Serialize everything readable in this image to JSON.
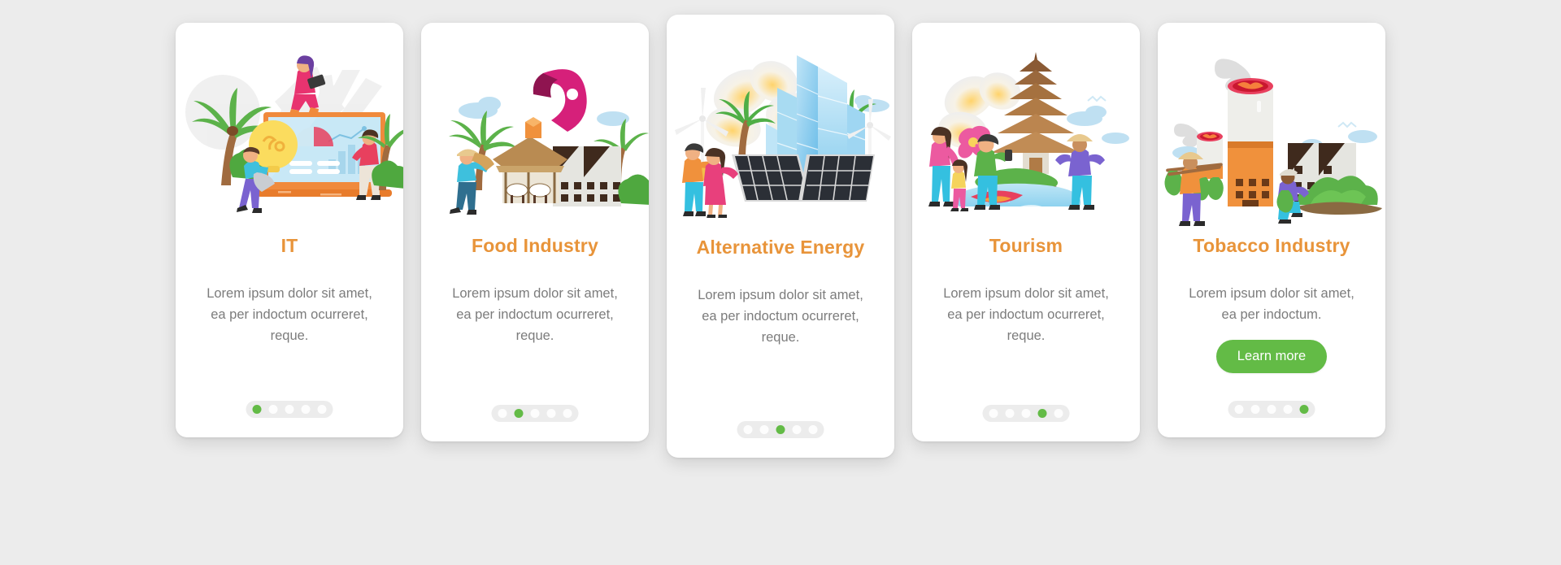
{
  "meta": {
    "accent_orange": "#e8943a",
    "accent_green": "#63bb46",
    "body_text_color": "#7c7c7c",
    "card_background": "#ffffff",
    "page_background": "#ececec",
    "dot_track_color": "#ececec"
  },
  "cards": [
    {
      "illustration": "it-illustration",
      "title": "IT",
      "description": "Lorem ipsum dolor sit amet, ea per indoctum ocurreret, reque.",
      "dots": {
        "total": 5,
        "active_index": 0
      },
      "button": null
    },
    {
      "illustration": "food-industry-illustration",
      "title": "Food Industry",
      "description": "Lorem ipsum dolor sit amet, ea per indoctum ocurreret, reque.",
      "dots": {
        "total": 5,
        "active_index": 1
      },
      "button": null
    },
    {
      "illustration": "alternative-energy-illustration",
      "title": "Alternative Energy",
      "description": "Lorem ipsum dolor sit amet, ea per indoctum ocurreret, reque.",
      "dots": {
        "total": 5,
        "active_index": 2
      },
      "button": null
    },
    {
      "illustration": "tourism-illustration",
      "title": "Tourism",
      "description": "Lorem ipsum dolor sit amet, ea per indoctum ocurreret, reque.",
      "dots": {
        "total": 5,
        "active_index": 3
      },
      "button": null
    },
    {
      "illustration": "tobacco-industry-illustration",
      "title": "Tobacco Industry",
      "description": "Lorem ipsum dolor sit amet, ea per indoctum.",
      "dots": {
        "total": 5,
        "active_index": 4
      },
      "button": {
        "label": "Learn more"
      }
    }
  ]
}
